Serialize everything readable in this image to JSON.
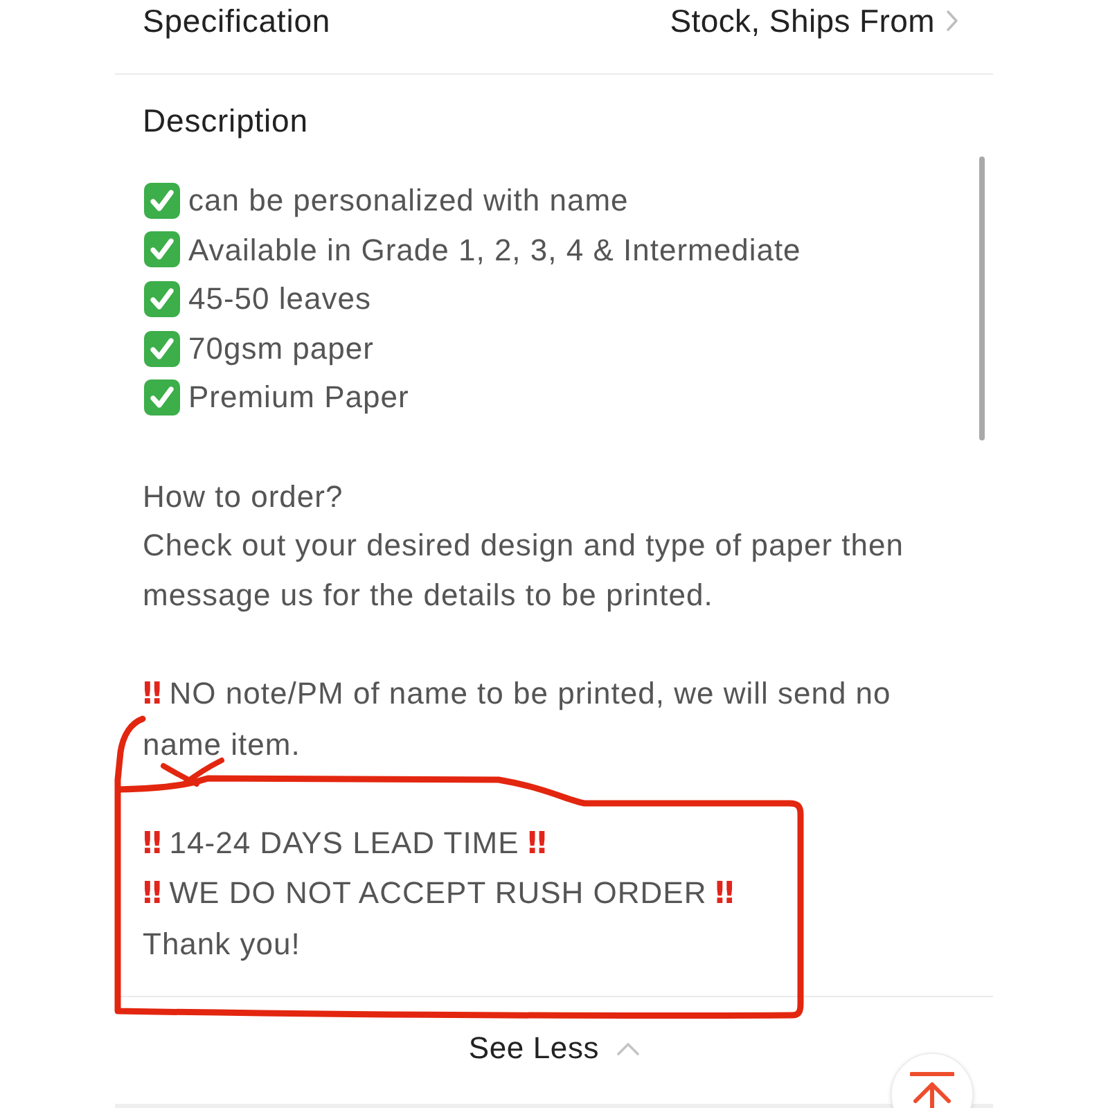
{
  "spec_row": {
    "label": "Specification",
    "value": "Stock, Ships From"
  },
  "description": {
    "title": "Description",
    "blocks": [
      {
        "kind": "checklist",
        "items": [
          "can be personalized with name",
          "Available in Grade 1, 2, 3, 4 & Intermediate",
          "45-50 leaves",
          "70gsm paper",
          "Premium Paper"
        ]
      },
      {
        "kind": "text",
        "circled": false,
        "lines": [
          {
            "text": "How to order?"
          },
          {
            "text": "Check out your desired design and type of paper then message us for the details to be printed."
          }
        ]
      },
      {
        "kind": "text",
        "circled": false,
        "lines": [
          {
            "lead": "‼",
            "text": "NO note/PM of name to be printed, we will send no name item."
          }
        ]
      },
      {
        "kind": "text",
        "circled": true,
        "lines": [
          {
            "lead": "‼",
            "text": "14-24 DAYS LEAD TIME",
            "trail": "‼"
          },
          {
            "lead": "‼",
            "text": "WE DO NOT ACCEPT RUSH ORDER",
            "trail": "‼"
          },
          {
            "text": "Thank you!"
          }
        ]
      }
    ]
  },
  "see_less": {
    "label": "See Less"
  }
}
